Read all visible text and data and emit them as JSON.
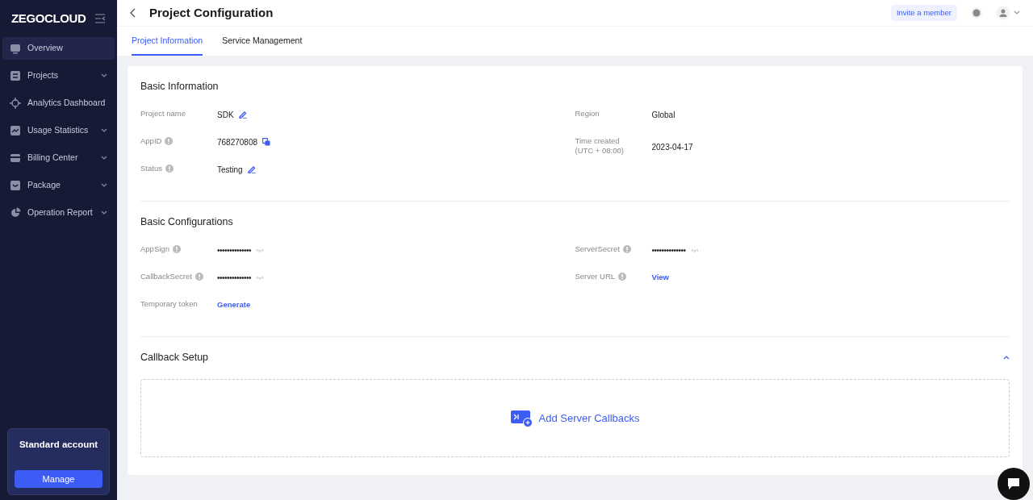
{
  "sidebar": {
    "logo": "ZEGOCLOUD",
    "items": [
      {
        "label": "Overview",
        "selected": true,
        "expandable": false
      },
      {
        "label": "Projects",
        "selected": false,
        "expandable": true
      },
      {
        "label": "Analytics Dashboard",
        "selected": false,
        "expandable": false
      },
      {
        "label": "Usage Statistics",
        "selected": false,
        "expandable": true
      },
      {
        "label": "Billing Center",
        "selected": false,
        "expandable": true
      },
      {
        "label": "Package",
        "selected": false,
        "expandable": true
      },
      {
        "label": "Operation Report",
        "selected": false,
        "expandable": true
      }
    ],
    "account": {
      "title": "Standard account",
      "button": "Manage"
    }
  },
  "header": {
    "title": "Project Configuration",
    "invite": "Invite a member"
  },
  "tabs": [
    {
      "label": "Project Information",
      "selected": true
    },
    {
      "label": "Service Management",
      "selected": false
    }
  ],
  "sections": [
    {
      "title": "Basic Information",
      "left": [
        {
          "label": "Project name",
          "info": false,
          "kind": "editable",
          "value": "SDK"
        },
        {
          "label": "AppID",
          "info": true,
          "kind": "copyable",
          "value": "768270808"
        },
        {
          "label": "Status",
          "info": true,
          "kind": "editable",
          "value": "Testing"
        }
      ],
      "right": [
        {
          "label": "Region",
          "info": false,
          "kind": "plain",
          "value": "Global"
        },
        {
          "label": "Time created\n(UTC + 08:00)",
          "info": false,
          "kind": "plain",
          "value": "2023-04-17"
        }
      ]
    },
    {
      "title": "Basic Configurations",
      "left": [
        {
          "label": "AppSign",
          "info": true,
          "kind": "masked",
          "value": "••••••••••••••"
        },
        {
          "label": "CallbackSecret",
          "info": true,
          "kind": "masked",
          "value": "••••••••••••••"
        },
        {
          "label": "Temporary token",
          "info": false,
          "kind": "link",
          "value": "Generate"
        }
      ],
      "right": [
        {
          "label": "ServerSecret",
          "info": true,
          "kind": "masked",
          "value": "••••••••••••••"
        },
        {
          "label": "Server URL",
          "info": true,
          "kind": "link",
          "value": "View"
        }
      ]
    },
    {
      "title": "Callback Setup",
      "expanded": true,
      "add": "Add Server Callbacks"
    }
  ]
}
